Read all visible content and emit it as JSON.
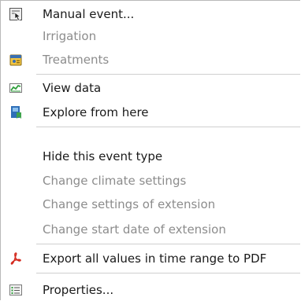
{
  "menu": {
    "items": [
      {
        "label": "Manual event...",
        "enabled": true,
        "icon": "manual-event-icon"
      },
      {
        "label": "Irrigation",
        "enabled": false,
        "icon": ""
      },
      {
        "label": "Treatments",
        "enabled": false,
        "icon": "treatments-icon"
      },
      {
        "label": "View data",
        "enabled": true,
        "icon": "view-data-chart-icon"
      },
      {
        "label": "Explore from here",
        "enabled": true,
        "icon": "explore-icon"
      },
      {
        "label": "Hide this event type",
        "enabled": true,
        "icon": ""
      },
      {
        "label": "Change climate settings",
        "enabled": false,
        "icon": ""
      },
      {
        "label": "Change settings of extension",
        "enabled": false,
        "icon": ""
      },
      {
        "label": "Change start date of extension",
        "enabled": false,
        "icon": ""
      },
      {
        "label": "Export all values in time range to PDF",
        "enabled": true,
        "icon": "pdf-icon"
      },
      {
        "label": "Properties...",
        "enabled": true,
        "icon": "properties-icon"
      }
    ]
  },
  "colors": {
    "text": "#1a1a1a",
    "disabled_text": "#8c8c8c",
    "separator": "#cfcfcf",
    "pdf_red": "#d42a1f",
    "chart_green": "#2e9e3a",
    "explore_blue": "#2f6fb8"
  }
}
